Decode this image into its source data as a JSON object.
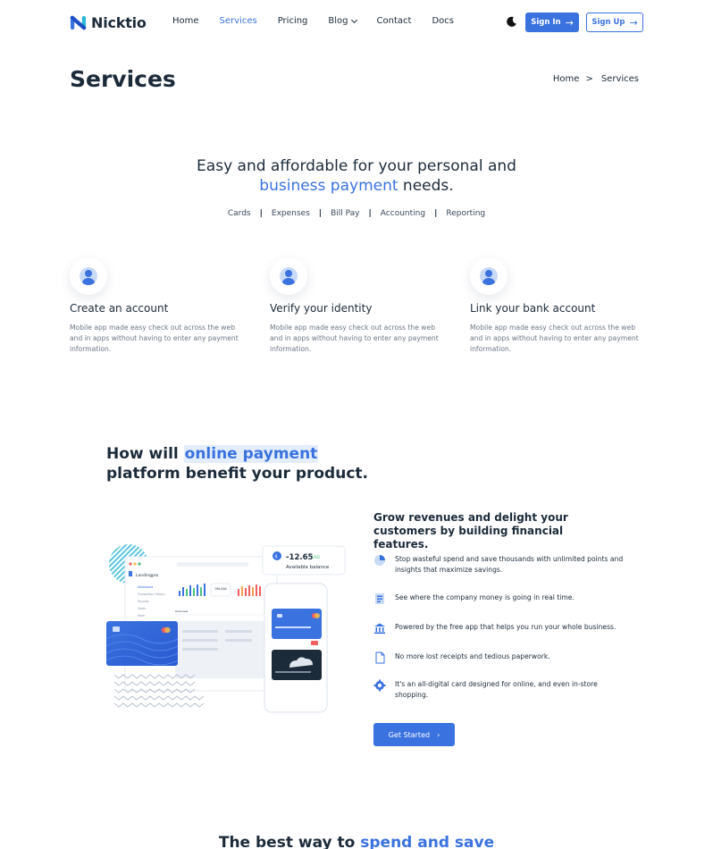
{
  "brand": {
    "name": "Nicktio",
    "accent": "#3a72e0"
  },
  "nav": {
    "items": [
      "Home",
      "Services",
      "Pricing",
      "Blog",
      "Contact",
      "Docs"
    ],
    "active": "Services",
    "theme_icon": "moon-icon",
    "sign_in": "Sign In",
    "sign_up": "Sign Up"
  },
  "page": {
    "title": "Services",
    "breadcrumb": [
      "Home",
      "Services"
    ]
  },
  "intro": {
    "line1": "Easy and affordable for your personal and",
    "highlight": "business payment",
    "line2_rest": " needs.",
    "tags": [
      "Cards",
      "Expenses",
      "Bill Pay",
      "Accounting",
      "Reporting"
    ]
  },
  "steps": [
    {
      "title": "Create an account",
      "text": "Mobile app made easy check out across the web and in apps without having to enter any payment information."
    },
    {
      "title": "Verify your identity",
      "text": "Mobile app made easy check out across the web and in apps without having to enter any payment information."
    },
    {
      "title": "Link your bank account",
      "text": "Mobile app made easy check out across the web and in apps without having to enter any payment information."
    }
  ],
  "benefit": {
    "heading_pre": "How will ",
    "heading_highlight": "online payment",
    "heading_line2": "platform benefit your product.",
    "illustration": {
      "balance": "-12.65",
      "currency": "USD",
      "balance_label": "Available balance",
      "app_name": "Landingpro",
      "sidebar": [
        "Dashboard",
        "Transaction History",
        "Payouts",
        "Cards",
        "More"
      ],
      "tab": "Overview",
      "value_label": "190,000"
    },
    "subheading": "Grow revenues and delight your customers by building financial features.",
    "features": [
      {
        "icon": "pie-chart-icon",
        "text": "Stop wasteful spend and save thousands with unlimited points and insights that maximize savings."
      },
      {
        "icon": "ledger-icon",
        "text": "See where the company money is going in real time."
      },
      {
        "icon": "bank-icon",
        "text": "Powered by the free app that helps you run your whole business."
      },
      {
        "icon": "document-icon",
        "text": "No more lost receipts and tedious paperwork."
      },
      {
        "icon": "gear-icon",
        "text": "It's an all-digital card designed for online, and even in-store shopping."
      }
    ],
    "cta": "Get Started"
  },
  "next_section": {
    "heading_pre": "The best way to ",
    "heading_highlight": "spend and save"
  }
}
